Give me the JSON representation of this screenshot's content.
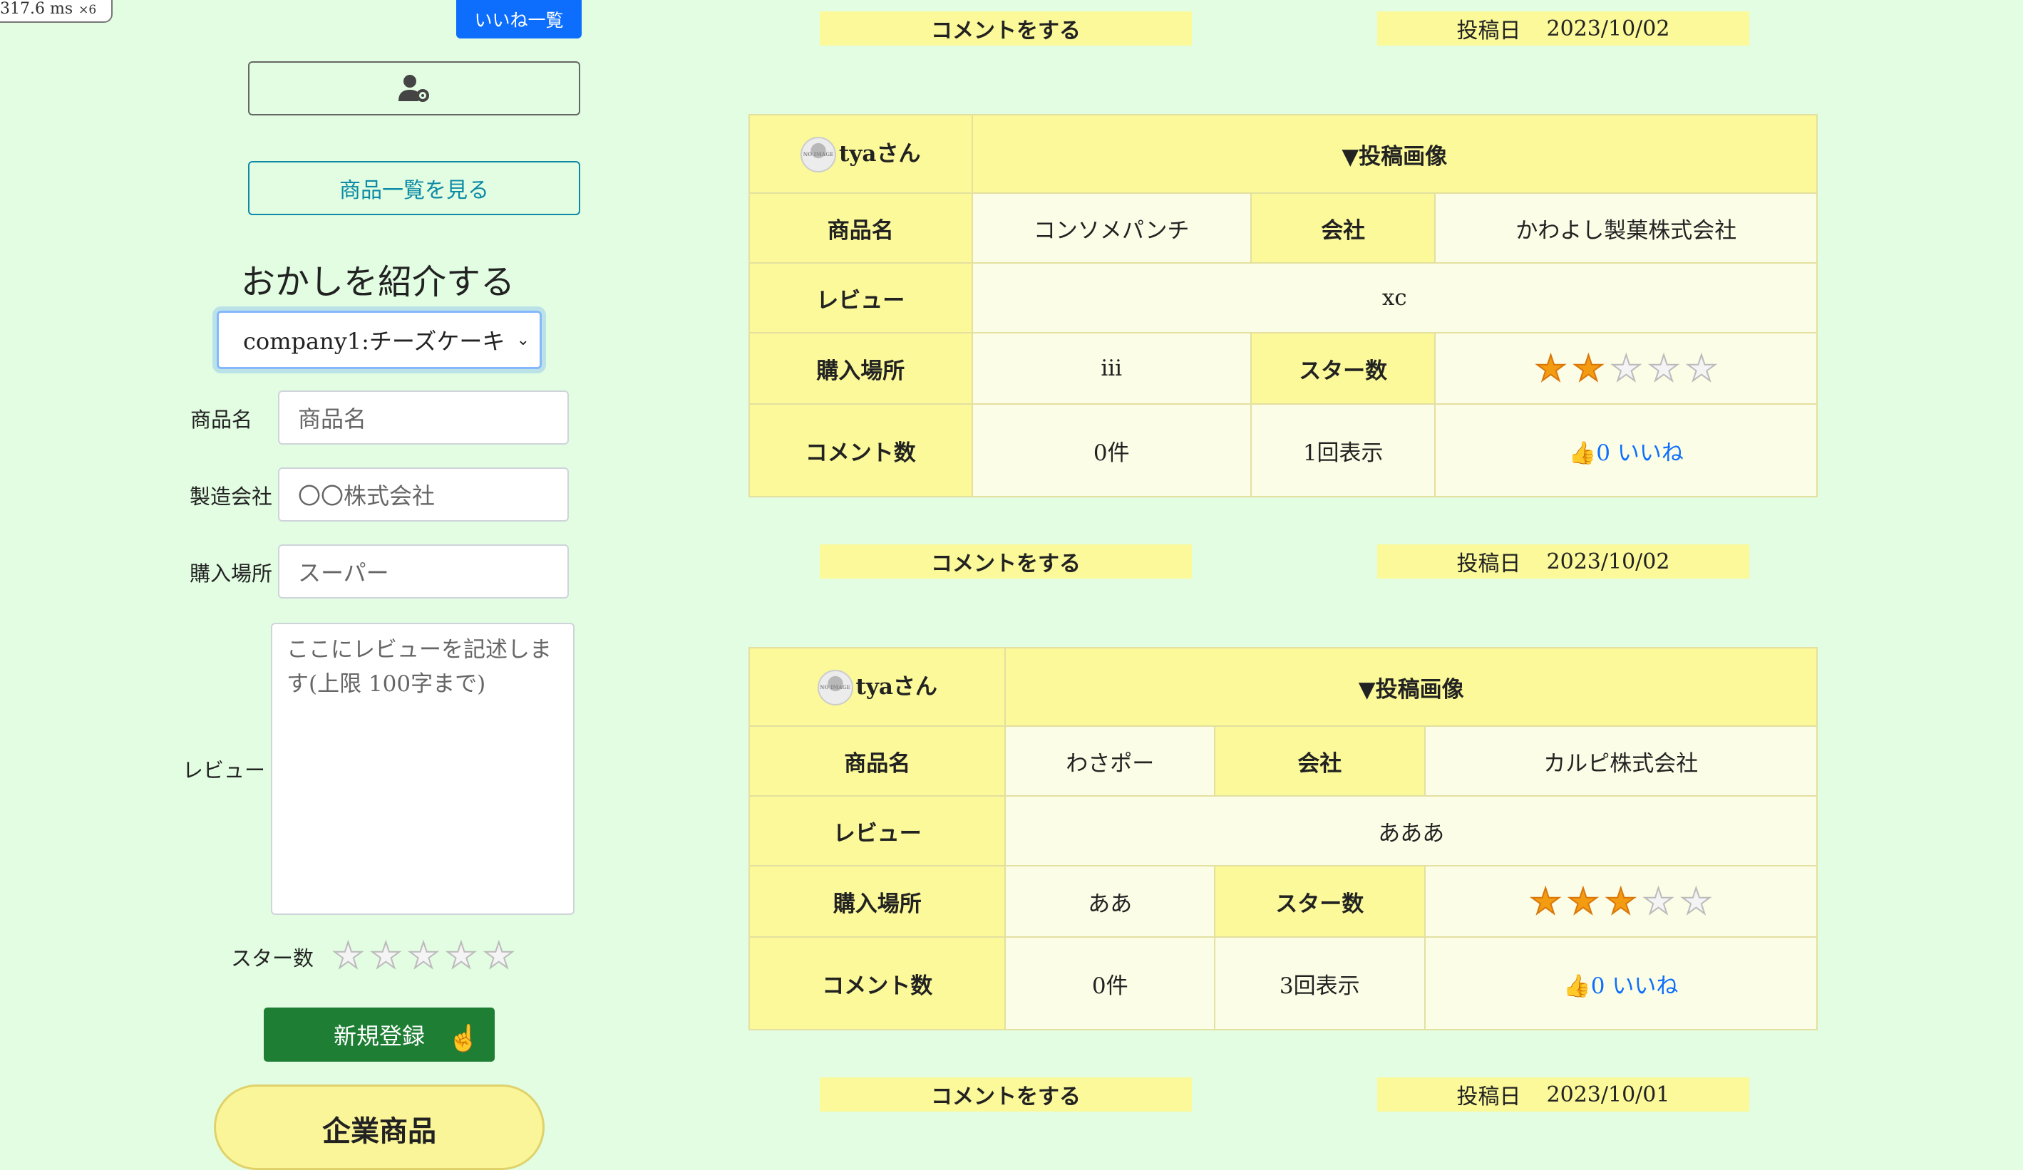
{
  "perf": {
    "time": "317.6 ms",
    "mult": "×6"
  },
  "header": {
    "likes_list": "いいね一覧"
  },
  "sidebar": {
    "products_button": "商品一覧を見る",
    "form_title": "おかしを紹介する",
    "select_value": "company1:チーズケーキ",
    "fields": {
      "product_label": "商品名",
      "product_placeholder": "商品名",
      "company_label": "製造会社",
      "company_placeholder": "〇〇株式会社",
      "place_label": "購入場所",
      "place_placeholder": "スーパー",
      "review_label": "レビュー",
      "review_placeholder": "ここにレビューを記述します(上限 100字まで)",
      "stars_label": "スター数"
    },
    "register_button": "新規登録",
    "category_pill": "企業商品"
  },
  "labels": {
    "comment_action": "コメントをする",
    "posted_date": "投稿日",
    "posted_image": "▼投稿画像",
    "product_name": "商品名",
    "company": "会社",
    "review": "レビュー",
    "place": "購入場所",
    "stars": "スター数",
    "comment_count": "コメント数",
    "like_suffix": "いいね",
    "no_image": "NO IMAGE"
  },
  "posts": [
    {
      "date": "2023/10/02",
      "user": "tyaさん",
      "product": "コンソメパンチ",
      "company": "かわよし製菓株式会社",
      "review": "xc",
      "place": "iii",
      "stars": 2,
      "comments": "0件",
      "views": "1回表示",
      "likes": "0"
    },
    {
      "date": "2023/10/02",
      "user": "tyaさん",
      "product": "わさポー",
      "company": "カルピ株式会社",
      "review": "あああ",
      "place": "ああ",
      "stars": 3,
      "comments": "0件",
      "views": "3回表示",
      "likes": "0"
    },
    {
      "date": "2023/10/01"
    }
  ],
  "colors": {
    "background": "#e2fde2",
    "header_cell": "#fbf999",
    "data_cell": "#fcfde6",
    "register": "#1e7e34",
    "primary": "#0d6efd",
    "star": "#f39c12"
  }
}
